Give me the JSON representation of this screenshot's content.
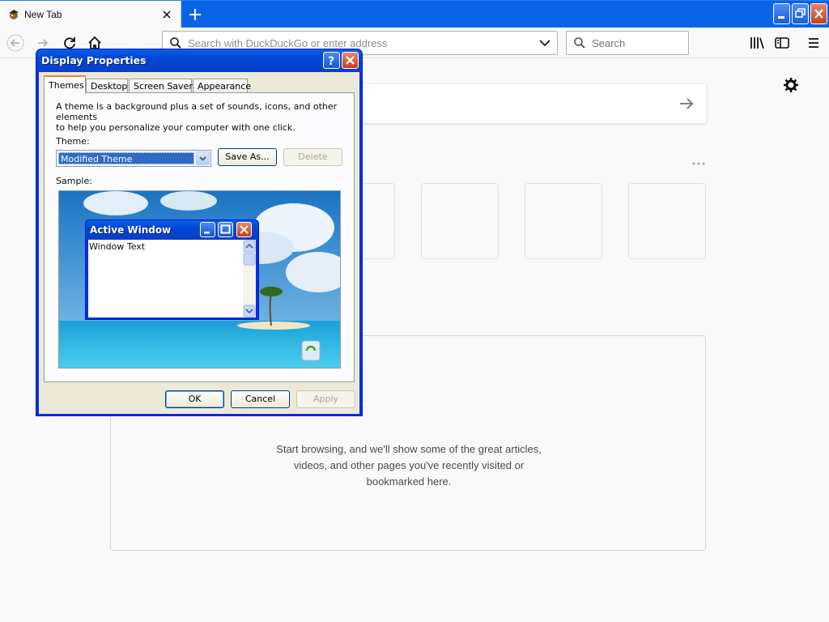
{
  "browser": {
    "tab_title": "New Tab",
    "url_placeholder": "Search with DuckDuckGo or enter address",
    "search_placeholder": "Search"
  },
  "newtab": {
    "empty_message_line1": "Start browsing, and we'll show some of the great articles,",
    "empty_message_line2": "videos, and other pages you've recently visited or",
    "empty_message_line3": "bookmarked here."
  },
  "dialog": {
    "title": "Display Properties",
    "tabs": [
      "Themes",
      "Desktop",
      "Screen Saver",
      "Appearance"
    ],
    "description_line1": "A theme is a background plus a set of sounds, icons, and other elements",
    "description_line2": "to help you personalize your computer with one click.",
    "theme_label": "Theme:",
    "theme_value": "Modified Theme",
    "save_as_label": "Save As...",
    "delete_label": "Delete",
    "sample_label": "Sample:",
    "preview_window_title": "Active Window",
    "preview_window_text": "Window Text",
    "ok_label": "OK",
    "cancel_label": "Cancel",
    "apply_label": "Apply"
  },
  "colors": {
    "xp_title_blue": "#0a3fc6",
    "browser_accent": "#0a64e6",
    "dialog_face": "#ece9d8"
  }
}
